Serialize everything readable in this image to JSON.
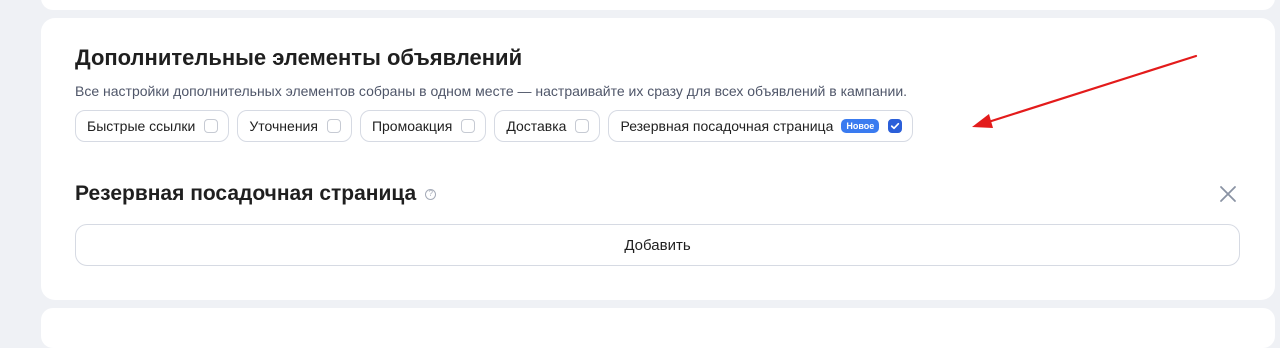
{
  "section": {
    "title": "Дополнительные элементы объявлений",
    "description": "Все настройки дополнительных элементов собраны в одном месте — настраивайте их сразу для всех объявлений в кампании."
  },
  "chips": [
    {
      "label": "Быстрые ссылки",
      "checked": false
    },
    {
      "label": "Уточнения",
      "checked": false
    },
    {
      "label": "Промоакция",
      "checked": false
    },
    {
      "label": "Доставка",
      "checked": false
    },
    {
      "label": "Резервная посадочная страница",
      "checked": true,
      "badge": "Новое"
    }
  ],
  "subsection": {
    "title": "Резервная посадочная страница",
    "help_icon": "question-circle-icon",
    "close_icon": "close-icon",
    "add_button": "Добавить"
  },
  "annotation": {
    "arrow_color": "#e31b1b"
  },
  "colors": {
    "accent": "#2b5fd9",
    "badge": "#3a7bf0",
    "background": "#eff1f5"
  }
}
